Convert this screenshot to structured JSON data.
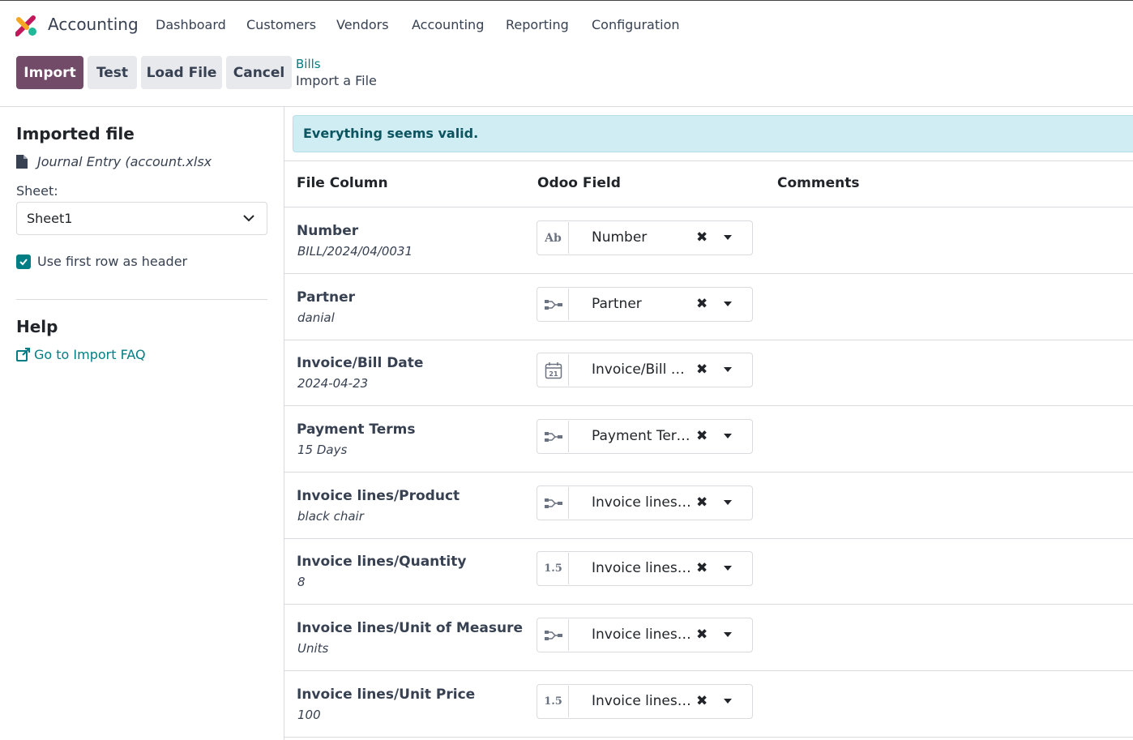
{
  "app": {
    "name": "Accounting"
  },
  "nav": [
    "Dashboard",
    "Customers",
    "Vendors",
    "Accounting",
    "Reporting",
    "Configuration"
  ],
  "toolbar": {
    "import_label": "Import",
    "test_label": "Test",
    "load_file_label": "Load File",
    "cancel_label": "Cancel"
  },
  "breadcrumb": {
    "parent": "Bills",
    "current": "Import a File"
  },
  "sidebar": {
    "imported_file_title": "Imported file",
    "file_name": "Journal Entry (account.xlsx",
    "sheet_label": "Sheet:",
    "sheet_value": "Sheet1",
    "first_row_header_label": "Use first row as header",
    "first_row_header_checked": true,
    "help_title": "Help",
    "faq_link": "Go to Import FAQ"
  },
  "alert": {
    "text": "Everything seems valid."
  },
  "table": {
    "headers": {
      "file_column": "File Column",
      "odoo_field": "Odoo Field",
      "comments": "Comments"
    },
    "rows": [
      {
        "column": "Number",
        "sample": "BILL/2024/04/0031",
        "field": "Number",
        "icon": "text-icon"
      },
      {
        "column": "Partner",
        "sample": "danial",
        "field": "Partner",
        "icon": "relation-icon"
      },
      {
        "column": "Invoice/Bill Date",
        "sample": "2024-04-23",
        "field": "Invoice/Bill Date",
        "icon": "calendar-icon"
      },
      {
        "column": "Payment Terms",
        "sample": "15 Days",
        "field": "Payment Terms",
        "icon": "relation-icon"
      },
      {
        "column": "Invoice lines/Product",
        "sample": "black chair",
        "field": "Invoice lines / Product",
        "icon": "relation-icon"
      },
      {
        "column": "Invoice lines/Quantity",
        "sample": "8",
        "field": "Invoice lines / Quantity",
        "icon": "decimal-icon"
      },
      {
        "column": "Invoice lines/Unit of Measure",
        "sample": "Units",
        "field": "Invoice lines / Unit of Measure",
        "icon": "relation-icon"
      },
      {
        "column": "Invoice lines/Unit Price",
        "sample": "100",
        "field": "Invoice lines / Unit Price",
        "icon": "decimal-icon"
      }
    ]
  },
  "colors": {
    "brand": "#714b67",
    "link": "#017e84",
    "alert_bg": "#cfedf2"
  }
}
